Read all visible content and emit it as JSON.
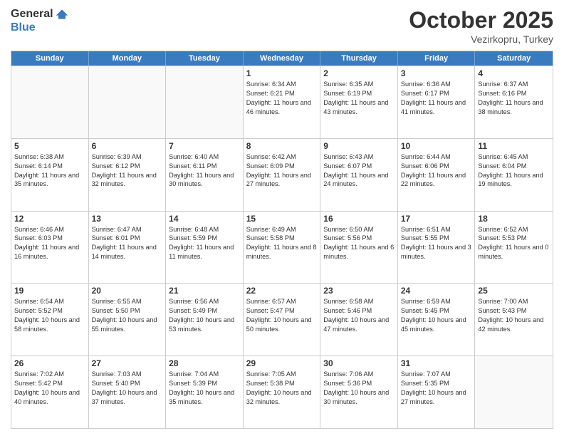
{
  "logo": {
    "general": "General",
    "blue": "Blue"
  },
  "header": {
    "month": "October 2025",
    "location": "Vezirkopru, Turkey"
  },
  "weekdays": [
    "Sunday",
    "Monday",
    "Tuesday",
    "Wednesday",
    "Thursday",
    "Friday",
    "Saturday"
  ],
  "weeks": [
    [
      {
        "day": "",
        "sunrise": "",
        "sunset": "",
        "daylight": ""
      },
      {
        "day": "",
        "sunrise": "",
        "sunset": "",
        "daylight": ""
      },
      {
        "day": "",
        "sunrise": "",
        "sunset": "",
        "daylight": ""
      },
      {
        "day": "1",
        "sunrise": "Sunrise: 6:34 AM",
        "sunset": "Sunset: 6:21 PM",
        "daylight": "Daylight: 11 hours and 46 minutes."
      },
      {
        "day": "2",
        "sunrise": "Sunrise: 6:35 AM",
        "sunset": "Sunset: 6:19 PM",
        "daylight": "Daylight: 11 hours and 43 minutes."
      },
      {
        "day": "3",
        "sunrise": "Sunrise: 6:36 AM",
        "sunset": "Sunset: 6:17 PM",
        "daylight": "Daylight: 11 hours and 41 minutes."
      },
      {
        "day": "4",
        "sunrise": "Sunrise: 6:37 AM",
        "sunset": "Sunset: 6:16 PM",
        "daylight": "Daylight: 11 hours and 38 minutes."
      }
    ],
    [
      {
        "day": "5",
        "sunrise": "Sunrise: 6:38 AM",
        "sunset": "Sunset: 6:14 PM",
        "daylight": "Daylight: 11 hours and 35 minutes."
      },
      {
        "day": "6",
        "sunrise": "Sunrise: 6:39 AM",
        "sunset": "Sunset: 6:12 PM",
        "daylight": "Daylight: 11 hours and 32 minutes."
      },
      {
        "day": "7",
        "sunrise": "Sunrise: 6:40 AM",
        "sunset": "Sunset: 6:11 PM",
        "daylight": "Daylight: 11 hours and 30 minutes."
      },
      {
        "day": "8",
        "sunrise": "Sunrise: 6:42 AM",
        "sunset": "Sunset: 6:09 PM",
        "daylight": "Daylight: 11 hours and 27 minutes."
      },
      {
        "day": "9",
        "sunrise": "Sunrise: 6:43 AM",
        "sunset": "Sunset: 6:07 PM",
        "daylight": "Daylight: 11 hours and 24 minutes."
      },
      {
        "day": "10",
        "sunrise": "Sunrise: 6:44 AM",
        "sunset": "Sunset: 6:06 PM",
        "daylight": "Daylight: 11 hours and 22 minutes."
      },
      {
        "day": "11",
        "sunrise": "Sunrise: 6:45 AM",
        "sunset": "Sunset: 6:04 PM",
        "daylight": "Daylight: 11 hours and 19 minutes."
      }
    ],
    [
      {
        "day": "12",
        "sunrise": "Sunrise: 6:46 AM",
        "sunset": "Sunset: 6:03 PM",
        "daylight": "Daylight: 11 hours and 16 minutes."
      },
      {
        "day": "13",
        "sunrise": "Sunrise: 6:47 AM",
        "sunset": "Sunset: 6:01 PM",
        "daylight": "Daylight: 11 hours and 14 minutes."
      },
      {
        "day": "14",
        "sunrise": "Sunrise: 6:48 AM",
        "sunset": "Sunset: 5:59 PM",
        "daylight": "Daylight: 11 hours and 11 minutes."
      },
      {
        "day": "15",
        "sunrise": "Sunrise: 6:49 AM",
        "sunset": "Sunset: 5:58 PM",
        "daylight": "Daylight: 11 hours and 8 minutes."
      },
      {
        "day": "16",
        "sunrise": "Sunrise: 6:50 AM",
        "sunset": "Sunset: 5:56 PM",
        "daylight": "Daylight: 11 hours and 6 minutes."
      },
      {
        "day": "17",
        "sunrise": "Sunrise: 6:51 AM",
        "sunset": "Sunset: 5:55 PM",
        "daylight": "Daylight: 11 hours and 3 minutes."
      },
      {
        "day": "18",
        "sunrise": "Sunrise: 6:52 AM",
        "sunset": "Sunset: 5:53 PM",
        "daylight": "Daylight: 11 hours and 0 minutes."
      }
    ],
    [
      {
        "day": "19",
        "sunrise": "Sunrise: 6:54 AM",
        "sunset": "Sunset: 5:52 PM",
        "daylight": "Daylight: 10 hours and 58 minutes."
      },
      {
        "day": "20",
        "sunrise": "Sunrise: 6:55 AM",
        "sunset": "Sunset: 5:50 PM",
        "daylight": "Daylight: 10 hours and 55 minutes."
      },
      {
        "day": "21",
        "sunrise": "Sunrise: 6:56 AM",
        "sunset": "Sunset: 5:49 PM",
        "daylight": "Daylight: 10 hours and 53 minutes."
      },
      {
        "day": "22",
        "sunrise": "Sunrise: 6:57 AM",
        "sunset": "Sunset: 5:47 PM",
        "daylight": "Daylight: 10 hours and 50 minutes."
      },
      {
        "day": "23",
        "sunrise": "Sunrise: 6:58 AM",
        "sunset": "Sunset: 5:46 PM",
        "daylight": "Daylight: 10 hours and 47 minutes."
      },
      {
        "day": "24",
        "sunrise": "Sunrise: 6:59 AM",
        "sunset": "Sunset: 5:45 PM",
        "daylight": "Daylight: 10 hours and 45 minutes."
      },
      {
        "day": "25",
        "sunrise": "Sunrise: 7:00 AM",
        "sunset": "Sunset: 5:43 PM",
        "daylight": "Daylight: 10 hours and 42 minutes."
      }
    ],
    [
      {
        "day": "26",
        "sunrise": "Sunrise: 7:02 AM",
        "sunset": "Sunset: 5:42 PM",
        "daylight": "Daylight: 10 hours and 40 minutes."
      },
      {
        "day": "27",
        "sunrise": "Sunrise: 7:03 AM",
        "sunset": "Sunset: 5:40 PM",
        "daylight": "Daylight: 10 hours and 37 minutes."
      },
      {
        "day": "28",
        "sunrise": "Sunrise: 7:04 AM",
        "sunset": "Sunset: 5:39 PM",
        "daylight": "Daylight: 10 hours and 35 minutes."
      },
      {
        "day": "29",
        "sunrise": "Sunrise: 7:05 AM",
        "sunset": "Sunset: 5:38 PM",
        "daylight": "Daylight: 10 hours and 32 minutes."
      },
      {
        "day": "30",
        "sunrise": "Sunrise: 7:06 AM",
        "sunset": "Sunset: 5:36 PM",
        "daylight": "Daylight: 10 hours and 30 minutes."
      },
      {
        "day": "31",
        "sunrise": "Sunrise: 7:07 AM",
        "sunset": "Sunset: 5:35 PM",
        "daylight": "Daylight: 10 hours and 27 minutes."
      },
      {
        "day": "",
        "sunrise": "",
        "sunset": "",
        "daylight": ""
      }
    ]
  ]
}
